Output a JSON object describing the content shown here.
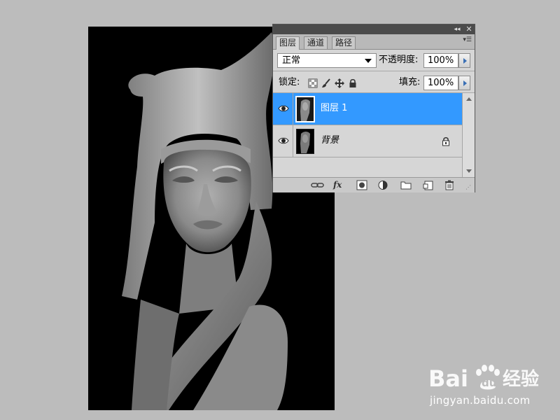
{
  "panel": {
    "tabs": [
      {
        "label": "图层",
        "active": true
      },
      {
        "label": "通道",
        "active": false
      },
      {
        "label": "路径",
        "active": false
      }
    ],
    "blend_mode": "正常",
    "opacity_label": "不透明度:",
    "opacity_value": "100%",
    "lock_label": "锁定:",
    "fill_label": "填充:",
    "fill_value": "100%",
    "layers": [
      {
        "name": "图层 1",
        "selected": true,
        "visible": true
      },
      {
        "name": "背景",
        "selected": false,
        "visible": true,
        "locked": true
      }
    ],
    "bottom_icons": [
      "link-icon",
      "fx-icon",
      "mask-icon",
      "adjustment-icon",
      "folder-icon",
      "new-layer-icon",
      "trash-icon"
    ],
    "fx_label": "fx",
    "selection_color": "#3399ff"
  },
  "document": {
    "content": "grayscale sculpture bust on black background"
  },
  "watermark": {
    "logo_text": "Bai du 经验",
    "url": "jingyan.baidu.com"
  }
}
